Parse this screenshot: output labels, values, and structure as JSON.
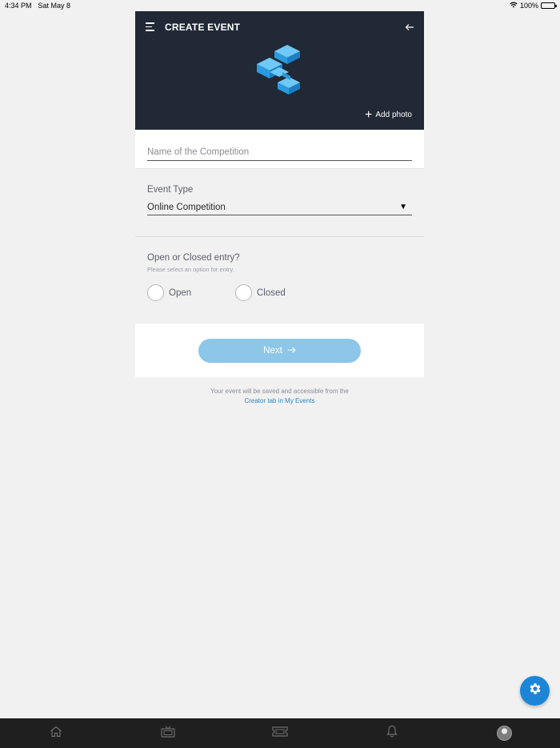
{
  "status_bar": {
    "time": "4:34 PM",
    "date": "Sat May 8",
    "battery": "100%",
    "battery_level": 1.0
  },
  "header": {
    "title": "CREATE EVENT",
    "add_photo": "Add photo"
  },
  "name_field": {
    "placeholder": "Name of the Competition",
    "value": ""
  },
  "event_type": {
    "label": "Event Type",
    "selected": "Online Competition"
  },
  "entry": {
    "label": "Open or Closed entry?",
    "help": "Please select an option for entry.",
    "options": [
      "Open",
      "Closed"
    ]
  },
  "next_button": {
    "label": "Next",
    "color": "#8cc6e9"
  },
  "footnote": {
    "text": "Your event will be saved and accessible from the",
    "link": "Creator tab in My Events"
  },
  "colors": {
    "header_bg": "#212836",
    "accent": "#1b86d6",
    "link": "#2b86c5"
  },
  "nav": {
    "items": [
      "home-icon",
      "tv-icon",
      "ticket-icon",
      "bell-icon",
      "avatar"
    ]
  }
}
